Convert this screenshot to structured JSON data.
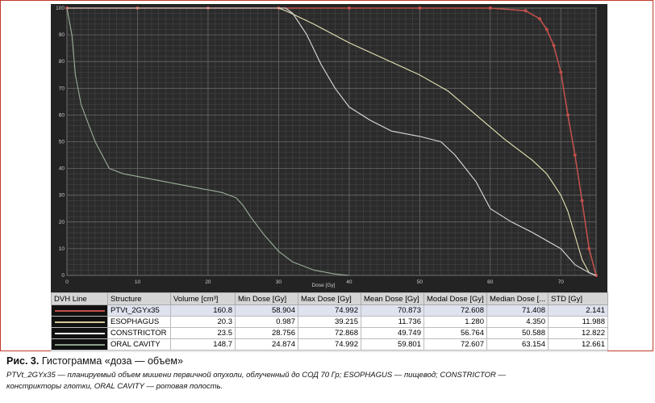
{
  "chart_data": {
    "type": "line",
    "xlabel": "Dose [Gy]",
    "ylabel": "",
    "xlim": [
      0,
      75
    ],
    "ylim": [
      0,
      100
    ],
    "x_ticks": [
      "0",
      "10",
      "20",
      "30",
      "40",
      "50",
      "60",
      "70"
    ],
    "y_ticks": [
      "0",
      "10",
      "20",
      "30",
      "40",
      "50",
      "60",
      "70",
      "80",
      "90",
      "100"
    ],
    "grid": true,
    "series": [
      {
        "color": "#c0504d",
        "markers": true,
        "x": [
          0,
          10,
          20,
          30,
          40,
          50,
          60,
          65,
          67,
          68,
          69,
          70,
          71,
          72,
          73,
          74,
          75
        ],
        "y": [
          100,
          100,
          100,
          100,
          100,
          100,
          100,
          99,
          96,
          92,
          86,
          76,
          60,
          45,
          28,
          10,
          0
        ]
      },
      {
        "color": "#e6e3b4",
        "markers": false,
        "x": [
          0,
          20,
          30,
          31,
          35,
          40,
          45,
          50,
          54,
          58,
          62,
          66,
          68,
          70,
          71,
          72,
          73,
          74,
          75
        ],
        "y": [
          100,
          100,
          100,
          99,
          94,
          87,
          81,
          75,
          69,
          60,
          51,
          43,
          38,
          30,
          24,
          15,
          6,
          1,
          0
        ]
      },
      {
        "color": "#dcdcdc",
        "markers": false,
        "x": [
          0,
          20,
          31,
          32,
          34,
          36,
          38,
          40,
          43,
          46,
          50,
          53,
          55,
          58,
          60,
          63,
          66,
          68,
          70,
          72,
          74,
          75
        ],
        "y": [
          100,
          100,
          100,
          98,
          90,
          79,
          70,
          63,
          58,
          54,
          52,
          50,
          45,
          35,
          25,
          20,
          16,
          13,
          10,
          4,
          1,
          0
        ]
      },
      {
        "color": "#9aaf98",
        "markers": false,
        "x": [
          0,
          0.7,
          1.2,
          2,
          3,
          4,
          5,
          6,
          8,
          12,
          18,
          22,
          24,
          25,
          26,
          28,
          30,
          32,
          35,
          38,
          40
        ],
        "y": [
          100,
          90,
          75,
          64,
          57,
          50,
          45,
          40,
          38,
          36,
          33,
          31,
          29,
          26,
          22,
          15,
          9,
          5,
          2,
          0.5,
          0
        ]
      }
    ]
  },
  "table": {
    "headers": [
      "DVH Line",
      "Structure",
      "Volume [cm³]",
      "Min Dose [Gy]",
      "Max Dose [Gy]",
      "Mean Dose [Gy]",
      "Modal Dose [Gy]",
      "Median Dose [...",
      "STD [Gy]"
    ],
    "rows": [
      {
        "color": "#c0504d",
        "structure": "PTVt_2GYx35",
        "volume": "160.8",
        "min": "58.904",
        "max": "74.992",
        "mean": "70.873",
        "modal": "72.608",
        "median": "71.408",
        "std": "2.141",
        "selected": true
      },
      {
        "color": "#d8c898",
        "structure": "ESOPHAGUS",
        "volume": "20.3",
        "min": "0.987",
        "max": "39.215",
        "mean": "11.736",
        "modal": "1.280",
        "median": "4.350",
        "std": "11.988",
        "selected": false
      },
      {
        "color": "#f0f0f0",
        "structure": "CONSTRICTOR",
        "volume": "23.5",
        "min": "28.756",
        "max": "72.868",
        "mean": "49.749",
        "modal": "56.764",
        "median": "50.588",
        "std": "12.822",
        "selected": false
      },
      {
        "color": "#8aa08a",
        "structure": "ORAL CAVITY",
        "volume": "148.7",
        "min": "24.874",
        "max": "74.992",
        "mean": "59.801",
        "modal": "72.607",
        "median": "63.154",
        "std": "12.661",
        "selected": false
      }
    ]
  },
  "caption": {
    "figure_label": "Рис. 3.",
    "title": "Гистограмма «доза — объем»",
    "line1": "PTVt_2GYx35 — планируемый объем мишени первичной опухоли, облученный до СОД 70 Гр; ESOPHAGUS — пищевод; CONSTRICTOR —",
    "line2": "констрикторы глотки, ORAL CAVITY — ротовая полость."
  }
}
